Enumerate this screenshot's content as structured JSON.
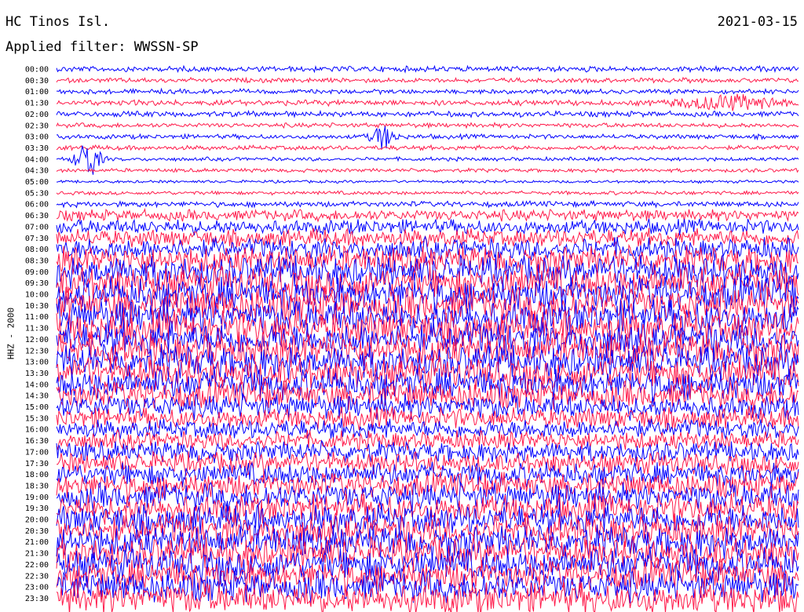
{
  "header": {
    "station": "HC Tinos Isl.",
    "date": "2021-03-15",
    "filter": "Applied filter: WWSSN-SP"
  },
  "chart_data": {
    "type": "line",
    "title": "HC Tinos Isl.",
    "ylabel": "HHZ - 2000",
    "row_labels": [
      "00:00",
      "00:30",
      "01:00",
      "01:30",
      "02:00",
      "02:30",
      "03:00",
      "03:30",
      "04:00",
      "04:30",
      "05:00",
      "05:30",
      "06:00",
      "06:30",
      "07:00",
      "07:30",
      "08:00",
      "08:30",
      "09:00",
      "09:30",
      "10:00",
      "10:30",
      "11:00",
      "11:30",
      "12:00",
      "12:30",
      "13:00",
      "13:30",
      "14:00",
      "14:30",
      "15:00",
      "15:30",
      "16:00",
      "16:30",
      "17:00",
      "17:30",
      "18:00",
      "18:30",
      "19:00",
      "19:30",
      "20:00",
      "20:30",
      "21:00",
      "21:30",
      "22:00",
      "22:30",
      "23:00",
      "23:30"
    ],
    "series_colors": [
      "#0000ff",
      "#ff1a4a"
    ],
    "relative_amplitude": [
      0.6,
      0.5,
      0.5,
      0.6,
      0.6,
      0.5,
      0.5,
      0.5,
      0.4,
      0.4,
      0.3,
      0.4,
      0.6,
      1.2,
      1.6,
      1.9,
      2.3,
      3.0,
      3.4,
      3.6,
      3.6,
      3.7,
      3.7,
      3.7,
      3.6,
      3.6,
      3.5,
      3.4,
      3.3,
      3.0,
      2.6,
      2.3,
      2.1,
      2.0,
      2.2,
      2.3,
      2.5,
      2.7,
      2.9,
      3.1,
      3.2,
      3.3,
      3.4,
      3.4,
      3.4,
      3.3,
      3.3,
      3.4
    ],
    "events": [
      {
        "row": 8,
        "label": "04:00",
        "amplitude": 3.5
      },
      {
        "row": 6,
        "label": "03:00",
        "amplitude": 2.0
      },
      {
        "row": 3,
        "label": "01:30",
        "amplitude": 1.2
      }
    ]
  }
}
